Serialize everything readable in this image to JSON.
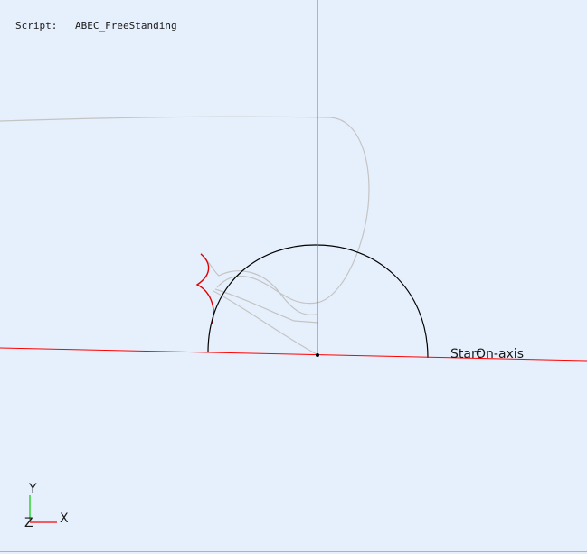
{
  "header": {
    "script_label": "Script:",
    "script_value": "ABEC_FreeStanding"
  },
  "viewport": {
    "background": "#e6f0fc",
    "axis_x_color": "#ff0000",
    "axis_y_color": "#00cc00",
    "arc_color": "#000000",
    "mesh_color": "#c4c4c4",
    "highlight_color": "#e00000"
  },
  "annotations": {
    "start_label": "Start",
    "onaxis_label": "On-axis"
  },
  "triad": {
    "y_label": "Y",
    "z_label": "Z",
    "x_label": "X",
    "y_color": "#00cc00",
    "x_color": "#ff0000"
  }
}
